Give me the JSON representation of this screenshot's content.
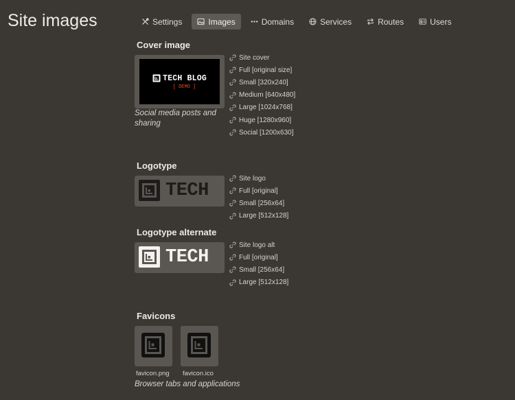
{
  "page": {
    "title": "Site images"
  },
  "nav": {
    "tabs": [
      {
        "label": "Settings",
        "icon": "wrench-icon"
      },
      {
        "label": "Images",
        "icon": "image-icon",
        "active": true
      },
      {
        "label": "Domains",
        "icon": "dots-icon"
      },
      {
        "label": "Services",
        "icon": "globe-icon"
      },
      {
        "label": "Routes",
        "icon": "arrows-icon"
      },
      {
        "label": "Users",
        "icon": "id-card-icon"
      }
    ]
  },
  "cover": {
    "title": "Cover image",
    "brand_text": "TECH BLOG",
    "demo_text": "[ DEMO ]",
    "caption": "Social media posts and sharing",
    "links": [
      "Site cover",
      "Full [original size]",
      "Small [320x240]",
      "Medium [640x480]",
      "Large [1024x768]",
      "Huge [1280x960]",
      "Social [1200x630]"
    ]
  },
  "logotype": {
    "title": "Logotype",
    "logo_text": "TECH",
    "links": [
      "Site logo",
      "Full [original]",
      "Small [256x64]",
      "Large [512x128]"
    ]
  },
  "logotype_alt": {
    "title": "Logotype alternate",
    "logo_text": "TECH",
    "links": [
      "Site logo alt",
      "Full [original]",
      "Small [256x64]",
      "Large [512x128]"
    ]
  },
  "favicons": {
    "title": "Favicons",
    "items": [
      "favicon.png",
      "favicon.ico"
    ],
    "caption": "Browser tabs and applications"
  },
  "colors": {
    "background": "#3b3733",
    "tile": "#5a5651",
    "active_tab": "#5d5954",
    "demo_accent": "#e8501e"
  }
}
